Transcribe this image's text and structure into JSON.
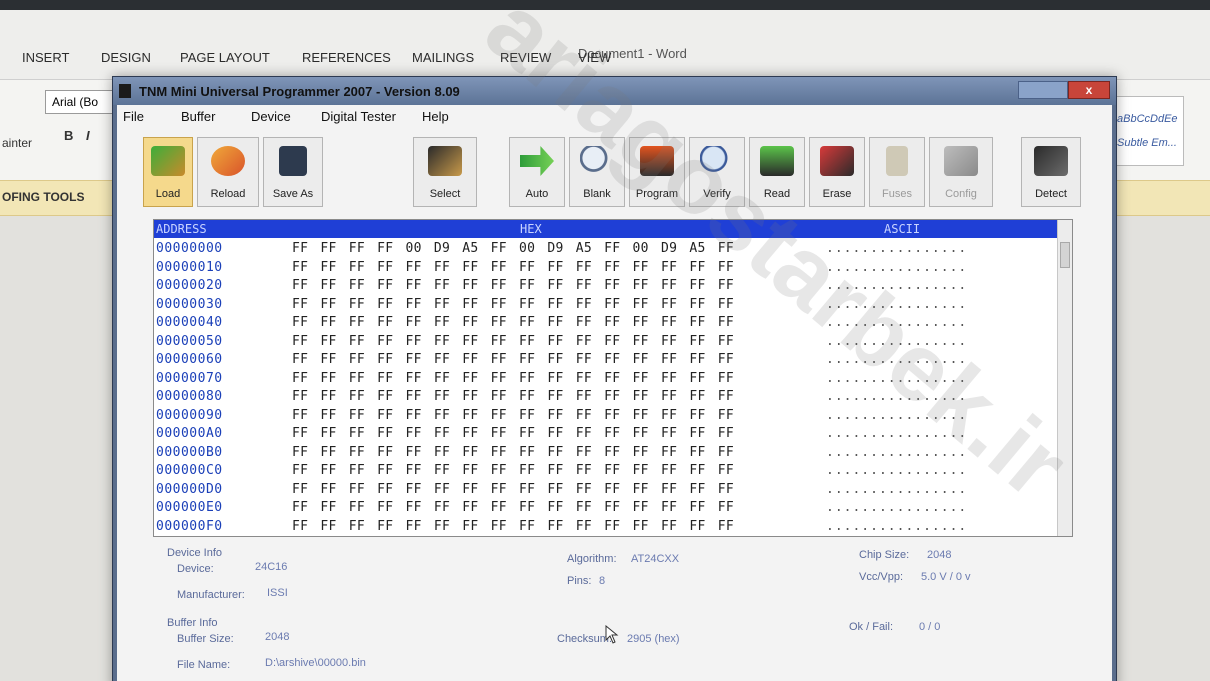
{
  "word": {
    "tabs": [
      "INSERT",
      "DESIGN",
      "PAGE LAYOUT",
      "REFERENCES",
      "MAILINGS",
      "REVIEW",
      "VIEW"
    ],
    "title": "Document1 - Word",
    "font_name": "Arial (Bo",
    "bold": "B",
    "italic": "I",
    "painter": "ainter",
    "proofing": "OFING TOOLS",
    "styles": [
      "aBbCcDdEe",
      "Subtle Em..."
    ]
  },
  "tnm": {
    "title": "TNM Mini Universal Programmer 2007 - Version 8.09",
    "close": "x",
    "menu": [
      "File",
      "Buffer",
      "Device",
      "Digital Tester",
      "Help"
    ],
    "toolbar": [
      {
        "label": "Load",
        "icon": "load-icon",
        "active": true,
        "disabled": false
      },
      {
        "label": "Reload",
        "icon": "reload-icon",
        "active": false,
        "disabled": false
      },
      {
        "label": "Save As",
        "icon": "save-icon",
        "active": false,
        "disabled": false
      },
      {
        "label": "Select",
        "icon": "select-chip-icon",
        "active": false,
        "disabled": false
      },
      {
        "label": "Auto",
        "icon": "auto-arrow-icon",
        "active": false,
        "disabled": false
      },
      {
        "label": "Blank",
        "icon": "blank-magnifier-icon",
        "active": false,
        "disabled": false
      },
      {
        "label": "Program",
        "icon": "program-icon",
        "active": false,
        "disabled": false
      },
      {
        "label": "Verify",
        "icon": "verify-icon",
        "active": false,
        "disabled": false
      },
      {
        "label": "Read",
        "icon": "read-icon",
        "active": false,
        "disabled": false
      },
      {
        "label": "Erase",
        "icon": "erase-icon",
        "active": false,
        "disabled": false
      },
      {
        "label": "Fuses",
        "icon": "fuses-lock-icon",
        "active": false,
        "disabled": true
      },
      {
        "label": "Config",
        "icon": "config-tools-icon",
        "active": false,
        "disabled": true
      },
      {
        "label": "Detect",
        "icon": "detect-icon",
        "active": false,
        "disabled": false
      }
    ],
    "hex": {
      "header_address": "ADDRESS",
      "header_hex": "HEX",
      "header_ascii": "ASCII",
      "rows": [
        {
          "addr": "00000000",
          "bytes": "FF FF FF FF 00 D9 A5 FF 00 D9 A5 FF 00 D9 A5 FF",
          "ascii": "................"
        },
        {
          "addr": "00000010",
          "bytes": "FF FF FF FF FF FF FF FF FF FF FF FF FF FF FF FF",
          "ascii": "................"
        },
        {
          "addr": "00000020",
          "bytes": "FF FF FF FF FF FF FF FF FF FF FF FF FF FF FF FF",
          "ascii": "................"
        },
        {
          "addr": "00000030",
          "bytes": "FF FF FF FF FF FF FF FF FF FF FF FF FF FF FF FF",
          "ascii": "................"
        },
        {
          "addr": "00000040",
          "bytes": "FF FF FF FF FF FF FF FF FF FF FF FF FF FF FF FF",
          "ascii": "................"
        },
        {
          "addr": "00000050",
          "bytes": "FF FF FF FF FF FF FF FF FF FF FF FF FF FF FF FF",
          "ascii": "................"
        },
        {
          "addr": "00000060",
          "bytes": "FF FF FF FF FF FF FF FF FF FF FF FF FF FF FF FF",
          "ascii": "................"
        },
        {
          "addr": "00000070",
          "bytes": "FF FF FF FF FF FF FF FF FF FF FF FF FF FF FF FF",
          "ascii": "................"
        },
        {
          "addr": "00000080",
          "bytes": "FF FF FF FF FF FF FF FF FF FF FF FF FF FF FF FF",
          "ascii": "................"
        },
        {
          "addr": "00000090",
          "bytes": "FF FF FF FF FF FF FF FF FF FF FF FF FF FF FF FF",
          "ascii": "................"
        },
        {
          "addr": "000000A0",
          "bytes": "FF FF FF FF FF FF FF FF FF FF FF FF FF FF FF FF",
          "ascii": "................"
        },
        {
          "addr": "000000B0",
          "bytes": "FF FF FF FF FF FF FF FF FF FF FF FF FF FF FF FF",
          "ascii": "................"
        },
        {
          "addr": "000000C0",
          "bytes": "FF FF FF FF FF FF FF FF FF FF FF FF FF FF FF FF",
          "ascii": "................"
        },
        {
          "addr": "000000D0",
          "bytes": "FF FF FF FF FF FF FF FF FF FF FF FF FF FF FF FF",
          "ascii": "................"
        },
        {
          "addr": "000000E0",
          "bytes": "FF FF FF FF FF FF FF FF FF FF FF FF FF FF FF FF",
          "ascii": "................"
        },
        {
          "addr": "000000F0",
          "bytes": "FF FF FF FF FF FF FF FF FF FF FF FF FF FF FF FF",
          "ascii": "................"
        }
      ]
    },
    "info": {
      "device_info_label": "Device Info",
      "device_label": "Device:",
      "device_value": "24C16",
      "manufacturer_label": "Manufacturer:",
      "manufacturer_value": "ISSI",
      "buffer_info_label": "Buffer Info",
      "buffer_size_label": "Buffer Size:",
      "buffer_size_value": "2048",
      "file_name_label": "File Name:",
      "file_name_value": "D:\\arshive\\00000.bin",
      "algorithm_label": "Algorithm:",
      "algorithm_value": "AT24CXX",
      "pins_label": "Pins:",
      "pins_value": "8",
      "checksum_label": "Checksum:",
      "checksum_value": "2905 (hex)",
      "chip_size_label": "Chip Size:",
      "chip_size_value": "2048",
      "vcc_label": "Vcc/Vpp:",
      "vcc_value": "5.0 V / 0 v",
      "okfail_label": "Ok / Fail:",
      "okfail_value": "0 / 0"
    }
  },
  "watermark_text": "ariagostarbek.ir"
}
